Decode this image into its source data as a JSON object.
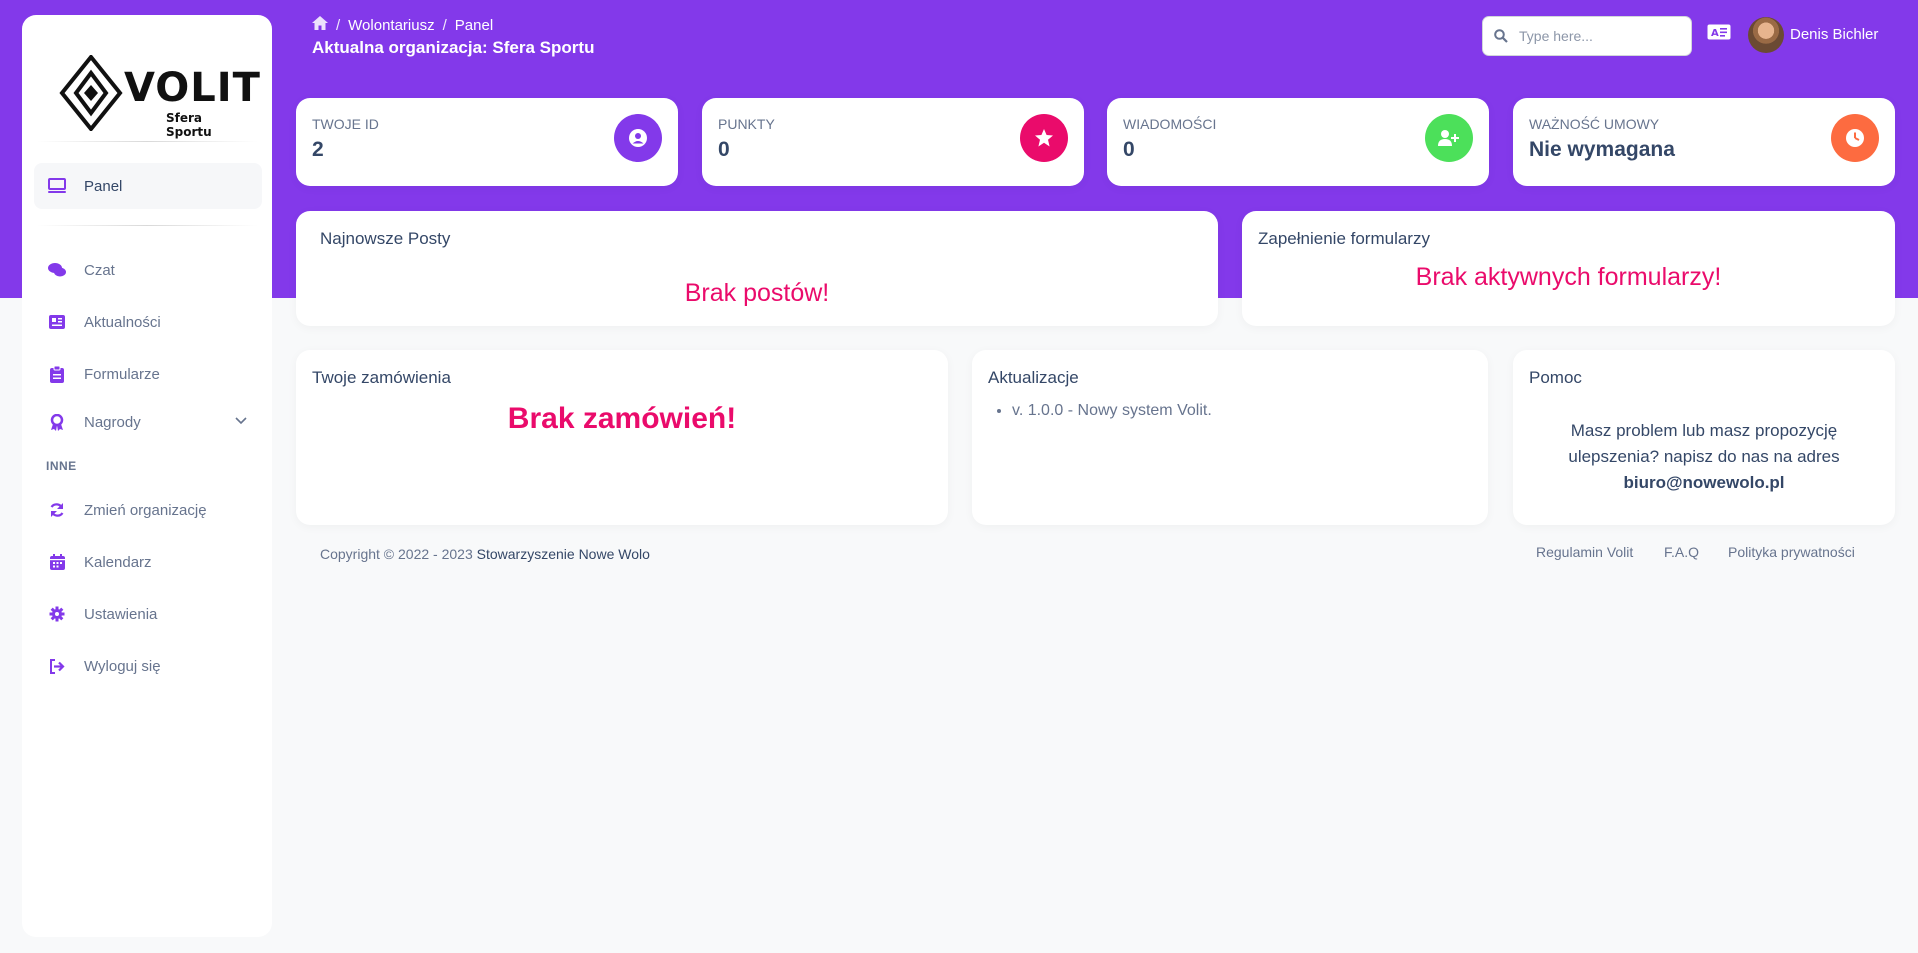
{
  "sidebar": {
    "logo": {
      "word": "VOLIT",
      "subtitle": "Sfera Sportu"
    },
    "active_item": {
      "label": "Panel",
      "icon": "monitor-icon"
    },
    "items": [
      {
        "label": "Czat",
        "icon": "chat-icon"
      },
      {
        "label": "Aktualności",
        "icon": "newspaper-icon"
      },
      {
        "label": "Formularze",
        "icon": "clipboard-icon"
      },
      {
        "label": "Nagrody",
        "icon": "award-icon"
      }
    ],
    "section_label": "INNE",
    "other_items": [
      {
        "label": "Zmień organizację",
        "icon": "refresh-icon"
      },
      {
        "label": "Kalendarz",
        "icon": "calendar-icon"
      },
      {
        "label": "Ustawienia",
        "icon": "gear-icon"
      },
      {
        "label": "Wyloguj się",
        "icon": "logout-icon"
      }
    ]
  },
  "header": {
    "breadcrumb": [
      "Wolontariusz",
      "Panel"
    ],
    "org_title": "Aktualna organizacja: Sfera Sportu",
    "search_placeholder": "Type here...",
    "user_name": "Denis Bichler"
  },
  "stats": [
    {
      "label": "TWOJE ID",
      "value": "2",
      "icon": "user-circle-icon",
      "color": "#8339ea"
    },
    {
      "label": "PUNKTY",
      "value": "0",
      "icon": "star-icon",
      "color": "#ea0b6b"
    },
    {
      "label": "WIADOMOŚCI",
      "value": "0",
      "icon": "user-plus-icon",
      "color": "#4ce05a"
    },
    {
      "label": "WAŻNOŚĆ UMOWY",
      "value": "Nie wymagana",
      "icon": "clock-icon",
      "color": "#fd6b40"
    }
  ],
  "posts": {
    "title": "Najnowsze Posty",
    "empty": "Brak postów!"
  },
  "forms": {
    "title": "Zapełnienie formularzy",
    "empty": "Brak aktywnych formularzy!"
  },
  "orders": {
    "title": "Twoje zamówienia",
    "empty": "Brak zamówień!"
  },
  "updates": {
    "title": "Aktualizacje",
    "items": [
      "v. 1.0.0 - Nowy system Volit."
    ]
  },
  "help": {
    "title": "Pomoc",
    "text": "Masz problem lub masz propozycję ulepszenia? napisz do nas na adres",
    "email": "biuro@nowewolo.pl"
  },
  "footer": {
    "copyright": "Copyright © 2022 - 2023",
    "org_link": "Stowarzyszenie Nowe Wolo",
    "links": [
      "Regulamin Volit",
      "F.A.Q",
      "Polityka prywatności"
    ]
  },
  "colors": {
    "primary": "#8339ea",
    "accent": "#ea0b6b",
    "text": "#344767",
    "muted": "#67748e"
  }
}
